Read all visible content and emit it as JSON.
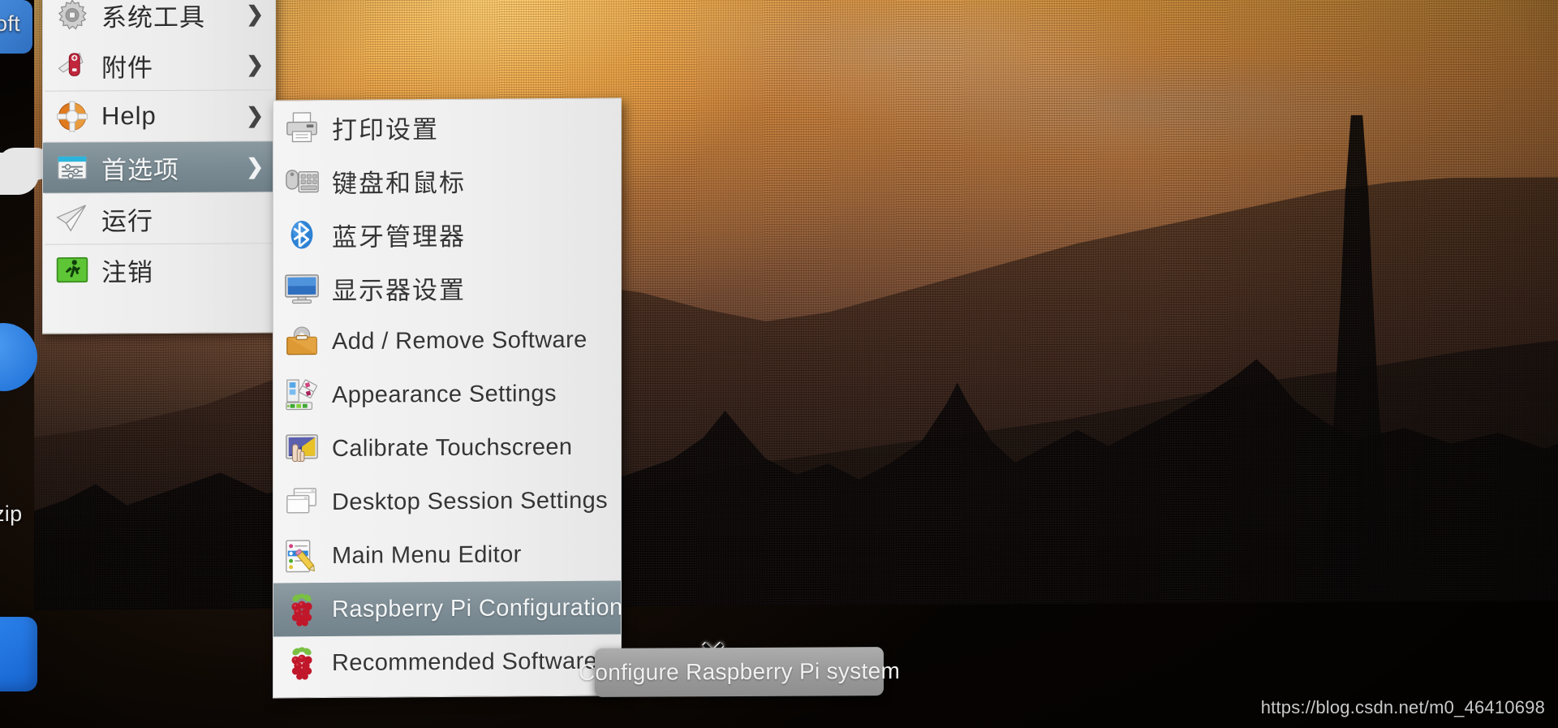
{
  "desktop": {
    "wallpaper_description": "sunset temple landscape",
    "icons": [
      {
        "name": "soft-shortcut",
        "label": "oft",
        "color": "#3b82d6"
      },
      {
        "name": "cloud-shortcut",
        "label": "",
        "color": "#e8e8e8"
      },
      {
        "name": "blue-round-shortcut",
        "label": "",
        "color": "#2a7fe0"
      },
      {
        "name": "zip-shortcut",
        "label": "zip",
        "color": "#2a7fe0"
      },
      {
        "name": "blue-app-shortcut",
        "label": "",
        "color": "#1e78e6"
      }
    ]
  },
  "root_menu": {
    "items": [
      {
        "label": "系统工具",
        "icon": "gear-icon",
        "has_submenu": true,
        "selected": false
      },
      {
        "label": "附件",
        "icon": "swiss-knife-icon",
        "has_submenu": true,
        "selected": false
      },
      {
        "label": "Help",
        "icon": "lifebuoy-icon",
        "has_submenu": true,
        "selected": false
      },
      {
        "label": "首选项",
        "icon": "preferences-icon",
        "has_submenu": true,
        "selected": true
      },
      {
        "label": "运行",
        "icon": "paper-plane-icon",
        "has_submenu": false,
        "selected": false
      },
      {
        "label": "注销",
        "icon": "exit-runner-icon",
        "has_submenu": false,
        "selected": false
      }
    ],
    "separator_after": [
      1,
      2,
      3,
      4
    ]
  },
  "sub_menu": {
    "title": "首选项",
    "items": [
      {
        "label": "打印设置",
        "icon": "printer-icon",
        "cjk": true,
        "selected": false
      },
      {
        "label": "键盘和鼠标",
        "icon": "keyboard-mouse-icon",
        "cjk": true,
        "selected": false
      },
      {
        "label": "蓝牙管理器",
        "icon": "bluetooth-icon",
        "cjk": true,
        "selected": false
      },
      {
        "label": "显示器设置",
        "icon": "monitor-icon",
        "cjk": true,
        "selected": false
      },
      {
        "label": "Add / Remove Software",
        "icon": "add-remove-software-icon",
        "cjk": false,
        "selected": false
      },
      {
        "label": "Appearance Settings",
        "icon": "appearance-icon",
        "cjk": false,
        "selected": false
      },
      {
        "label": "Calibrate Touchscreen",
        "icon": "calibrate-touchscreen-icon",
        "cjk": false,
        "selected": false
      },
      {
        "label": "Desktop Session Settings",
        "icon": "desktop-session-icon",
        "cjk": false,
        "selected": false
      },
      {
        "label": "Main Menu Editor",
        "icon": "main-menu-editor-icon",
        "cjk": false,
        "selected": false
      },
      {
        "label": "Raspberry Pi Configuration",
        "icon": "raspberry-icon",
        "cjk": false,
        "selected": true
      },
      {
        "label": "Recommended Software",
        "icon": "raspberry-icon",
        "cjk": false,
        "selected": false
      }
    ]
  },
  "tooltip": {
    "text": "Configure Raspberry Pi system"
  },
  "cursor": {
    "glyph": "✕",
    "type": "x-cursor"
  },
  "watermark": {
    "text": "https://blog.csdn.net/m0_46410698"
  },
  "colors": {
    "menu_bg": "#efefef",
    "menu_text": "#353535",
    "highlight_bg": "#7e8d95",
    "highlight_text": "#f2f5f6",
    "tooltip_bg": "#9b9b9b",
    "tooltip_text": "#f0f0f0",
    "accent_raspberry": "#c0172a",
    "accent_bluetooth": "#2878c8"
  }
}
